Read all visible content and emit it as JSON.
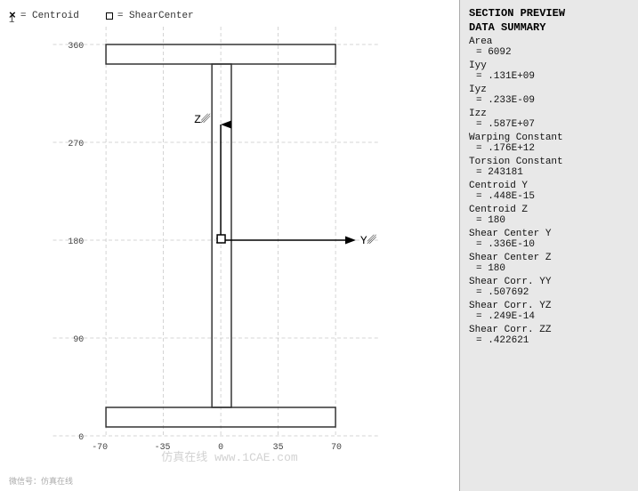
{
  "legend": {
    "centroid_symbol": "×",
    "centroid_label": "= Centroid",
    "shear_label": "= ShearCenter"
  },
  "panel": {
    "title1": "SECTION PREVIEW",
    "title2": "DATA SUMMARY",
    "rows": [
      {
        "label": "Area",
        "value": "= 6092"
      },
      {
        "label": "Iyy",
        "value": "= .131E+09"
      },
      {
        "label": "Iyz",
        "value": "= .233E-09"
      },
      {
        "label": "Izz",
        "value": "= .587E+07"
      },
      {
        "label": "Warping Constant",
        "value": "= .176E+12"
      },
      {
        "label": "Torsion Constant",
        "value": "= 243181"
      },
      {
        "label": "Centroid Y",
        "value": "= .448E-15"
      },
      {
        "label": "Centroid Z",
        "value": "= 180"
      },
      {
        "label": "Shear Center Y",
        "value": "= .336E-10"
      },
      {
        "label": "Shear Center Z",
        "value": "= 180"
      },
      {
        "label": "Shear Corr. YY",
        "value": "= .507692"
      },
      {
        "label": "Shear Corr. YZ",
        "value": "= .249E-14"
      },
      {
        "label": "Shear Corr. ZZ",
        "value": "= .422621"
      }
    ]
  },
  "axes": {
    "y_label": "Y",
    "z_label": "Z",
    "x_ticks": [
      "-70",
      "-35",
      "0",
      "35",
      "70"
    ],
    "y_ticks": [
      "0",
      "90",
      "180",
      "270",
      "360"
    ]
  },
  "watermark": "仿真在线 www.1CAE.com"
}
